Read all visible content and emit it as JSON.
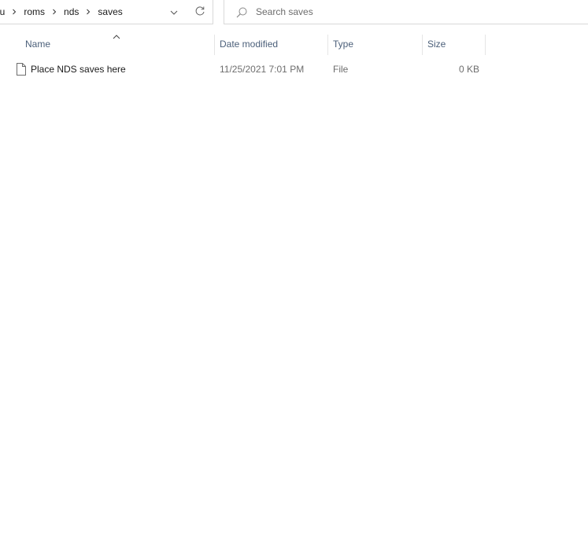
{
  "address_bar": {
    "breadcrumb": [
      "nu",
      "roms",
      "nds",
      "saves"
    ],
    "separator_icon": "chevron-right-icon",
    "dropdown_icon": "chevron-down-icon",
    "refresh_icon": "refresh-icon"
  },
  "search": {
    "placeholder": "Search saves",
    "value": "",
    "icon": "search-icon"
  },
  "columns": {
    "name": "Name",
    "date_modified": "Date modified",
    "type": "Type",
    "size": "Size",
    "sorted_by": "Name",
    "sort_icon": "sort-up-icon"
  },
  "files": [
    {
      "name": "Place NDS saves here",
      "date_modified": "11/25/2021 7:01 PM",
      "type": "File",
      "size": "0 KB",
      "icon": "file-icon"
    }
  ],
  "colors": {
    "header_text": "#4c607a",
    "muted_text": "#6d6d6d",
    "border": "#d9d9d9"
  }
}
